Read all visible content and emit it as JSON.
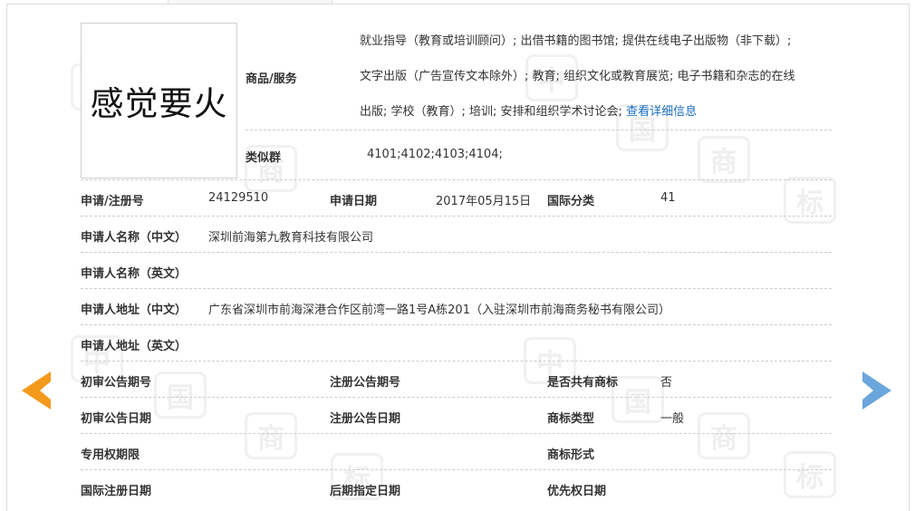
{
  "trademark": {
    "mark_text": "感觉要火",
    "goods_label": "商品/服务",
    "goods_lines": [
      "就业指导（教育或培训顾问）; 出借书籍的图书馆; 提供在线电子出版物（非下载）;",
      "文字出版（广告宣传文本除外）; 教育; 组织文化或教育展览; 电子书籍和杂志的在线",
      "出版; 学校（教育）; 培训; 安排和组织学术讨论会; "
    ],
    "goods_more_link": "查看详细信息",
    "similar_group_label": "类似群",
    "similar_group_value": "4101;4102;4103;4104;"
  },
  "fields": {
    "reg_no_label": "申请/注册号",
    "reg_no_value": "24129510",
    "apply_date_label": "申请日期",
    "apply_date_value": "2017年05月15日",
    "intl_class_label": "国际分类",
    "intl_class_value": "41",
    "applicant_cn_label": "申请人名称（中文）",
    "applicant_cn_value": "深圳前海第九教育科技有限公司",
    "applicant_en_label": "申请人名称（英文）",
    "address_cn_label": "申请人地址（中文）",
    "address_cn_value": "广东省深圳市前海深港合作区前湾一路1号A栋201（入驻深圳市前海商务秘书有限公司）",
    "address_en_label": "申请人地址（英文）",
    "prelim_pub_no_label": "初审公告期号",
    "reg_pub_no_label": "注册公告期号",
    "shared_label": "是否共有商标",
    "shared_value": "否",
    "prelim_pub_date_label": "初审公告日期",
    "reg_pub_date_label": "注册公告日期",
    "mark_type_label": "商标类型",
    "mark_type_value": "一般",
    "exclusive_period_label": "专用权期限",
    "mark_form_label": "商标形式",
    "intl_reg_date_label": "国际注册日期",
    "later_designation_label": "后期指定日期",
    "priority_date_label": "优先权日期"
  },
  "watermark": {
    "glyphs": [
      "中",
      "国",
      "商",
      "标"
    ]
  },
  "nav": {
    "prev_icon": "arrow-left-icon",
    "next_icon": "arrow-right-icon",
    "prev_color": "#f39a1d",
    "next_color": "#6aa6dc"
  }
}
